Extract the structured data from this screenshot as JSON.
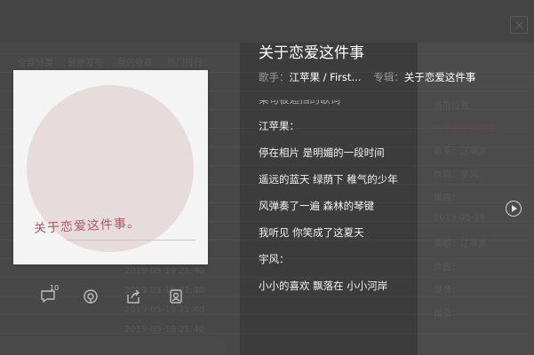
{
  "song": {
    "title": "关于恋爱这件事",
    "singer_label": "歌手：",
    "singer": "江苹果 / First...",
    "album_label": "专辑：",
    "album": "关于恋爱这件事"
  },
  "cover": {
    "text": "关于恋爱这件事。"
  },
  "lyrics": [
    {
      "text": "某句被遮挡的歌词",
      "faded": true
    },
    {
      "text": "江苹果：",
      "faded": false
    },
    {
      "text": "停在相片 是明媚的一段时间",
      "faded": false
    },
    {
      "text": "遥远的蓝天 绿荫下 稚气的少年",
      "faded": false
    },
    {
      "text": "风弹奏了一遍 森林的琴键",
      "faded": false
    },
    {
      "text": "我听见 你笑成了这夏天",
      "faded": false
    },
    {
      "text": "宇风：",
      "faded": false
    },
    {
      "text": "小小的喜欢 飘落在 小小河岸",
      "faded": false
    }
  ],
  "actions": {
    "comment_count": "10",
    "icons": [
      "comment-icon",
      "share-radio-icon",
      "share-icon",
      "download-icon"
    ]
  },
  "background": {
    "ghost_left": [
      "全部分类",
      "最新发布",
      "我的收藏",
      "热门排行",
      "2019-05-19 21:40",
      "2019-05-19 21:40",
      "2019-05-19 21:40",
      "2019-05-19 21:40"
    ],
    "ghost_right": [
      "当前位置",
      "关于恋爱这件事",
      "歌手：江苹果",
      "作词：宇风",
      "编曲：",
      "2019-05-19",
      "演唱：江苹果",
      "作曲：",
      "混音：",
      "出品："
    ]
  }
}
